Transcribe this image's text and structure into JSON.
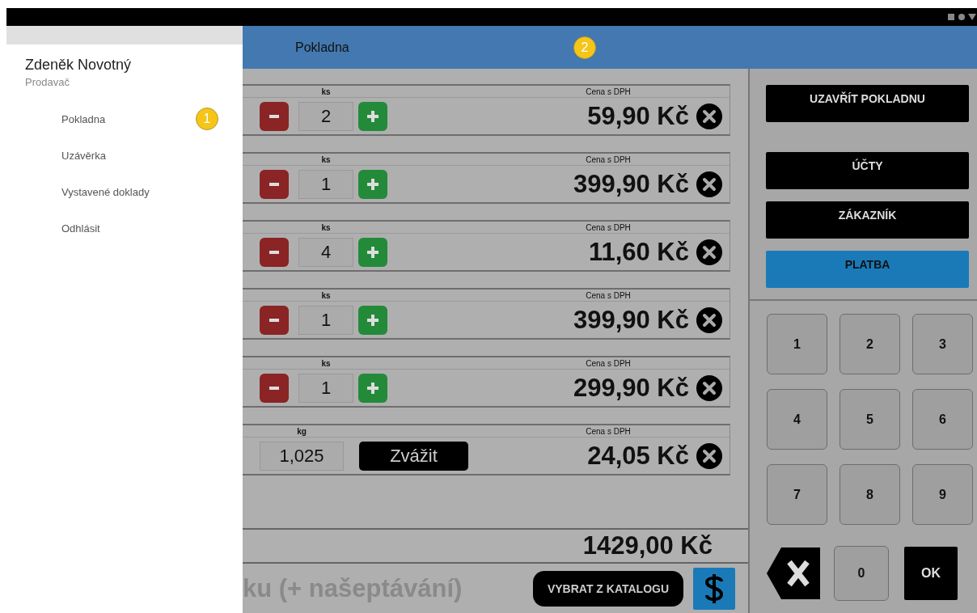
{
  "drawer": {
    "user_name": "Zdeněk Novotný",
    "role": "Prodavač",
    "items": [
      {
        "label": "Pokladna",
        "marker": "1"
      },
      {
        "label": "Uzávěrka"
      },
      {
        "label": "Vystavené doklady"
      },
      {
        "label": "Odhlásit"
      }
    ]
  },
  "app_bar": {
    "title": "Pokladna",
    "marker": "2"
  },
  "items": [
    {
      "kind": "count",
      "unit_label": "ks",
      "quantity": "2",
      "price_label": "Cena s DPH",
      "price": "59,90 Kč"
    },
    {
      "kind": "count",
      "unit_label": "ks",
      "quantity": "1",
      "price_label": "Cena s DPH",
      "price": "399,90 Kč"
    },
    {
      "kind": "count",
      "unit_label": "ks",
      "quantity": "4",
      "price_label": "Cena s DPH",
      "price": "11,60 Kč"
    },
    {
      "kind": "count",
      "unit_label": "ks",
      "quantity": "1",
      "price_label": "Cena s DPH",
      "price": "399,90 Kč"
    },
    {
      "kind": "count",
      "unit_label": "ks",
      "quantity": "1",
      "price_label": "Cena s DPH",
      "price": "299,90 Kč"
    },
    {
      "kind": "weight",
      "unit_label": "kg",
      "quantity": "1,025",
      "action": "Zvážit",
      "price_label": "Cena s DPH",
      "price": "24,05 Kč"
    }
  ],
  "total": "1429,00 Kč",
  "search": {
    "placeholder": "ku (+ našeptávání)",
    "catalog_button": "VYBRAT Z KATALOGU"
  },
  "actions": [
    {
      "label": "UZAVŘÍT POKLADNU",
      "kind": "dark"
    },
    {
      "label": "ÚČTY",
      "kind": "dark"
    },
    {
      "label": "ZÁKAZNÍK",
      "kind": "dark"
    },
    {
      "label": "PLATBA",
      "kind": "primary"
    }
  ],
  "keypad": [
    [
      {
        "kind": "digit",
        "label": "1"
      },
      {
        "kind": "digit",
        "label": "2"
      },
      {
        "kind": "digit",
        "label": "3"
      }
    ],
    [
      {
        "kind": "digit",
        "label": "4"
      },
      {
        "kind": "digit",
        "label": "5"
      },
      {
        "kind": "digit",
        "label": "6"
      }
    ],
    [
      {
        "kind": "digit",
        "label": "7"
      },
      {
        "kind": "digit",
        "label": "8"
      },
      {
        "kind": "digit",
        "label": "9"
      }
    ],
    [
      {
        "kind": "backspace"
      },
      {
        "kind": "digit",
        "label": "0"
      },
      {
        "kind": "ok",
        "label": "OK"
      }
    ]
  ]
}
